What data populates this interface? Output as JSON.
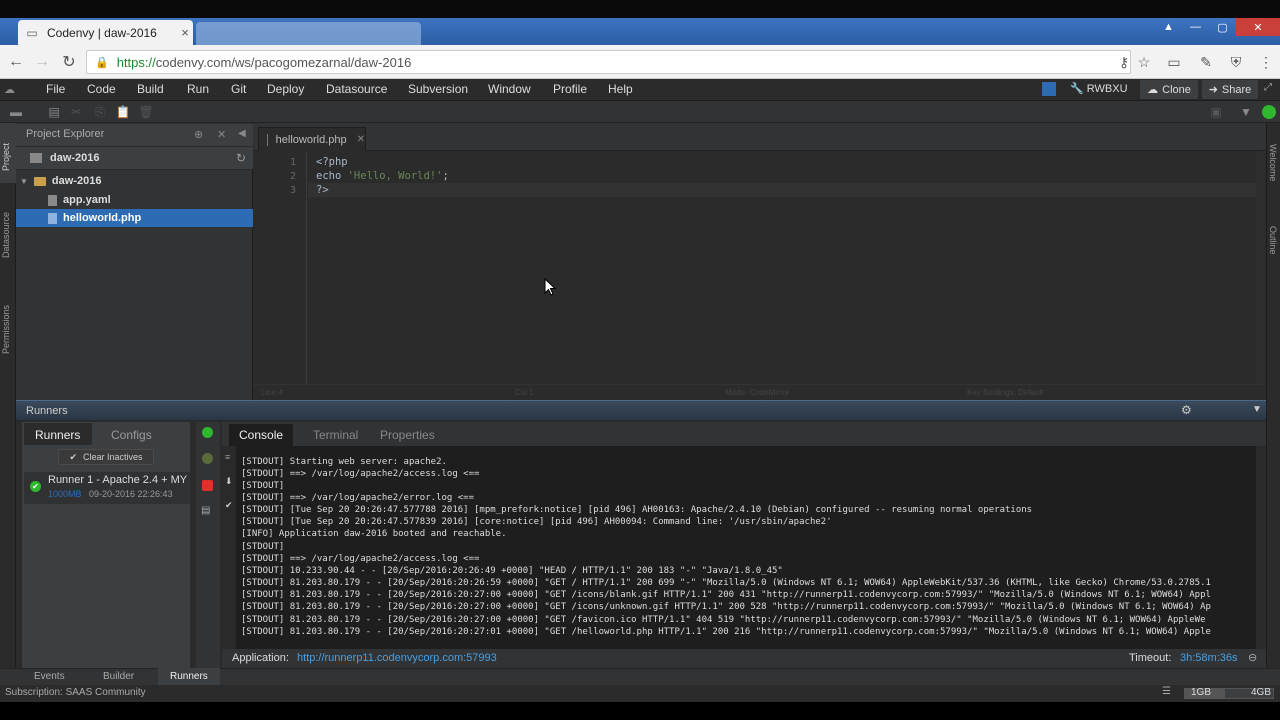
{
  "browser": {
    "tab_title": "Codenvy | daw-2016",
    "tab_close": "×",
    "url_scheme": "https://",
    "url_rest": "codenvy.com/ws/pacogomezarnal/daw-2016",
    "icons": [
      "back-icon",
      "forward-icon",
      "reload-icon",
      "lock-icon",
      "key-icon",
      "star-icon",
      "cast-icon",
      "extension-icon",
      "menu-icon"
    ]
  },
  "menu": [
    "File",
    "Code",
    "Build",
    "Run",
    "Git",
    "Deploy",
    "Datasource",
    "Subversion",
    "Window",
    "Profile",
    "Help"
  ],
  "menu_right": {
    "user": "RWBXU",
    "clone": "Clone",
    "share": "Share"
  },
  "left_strip": [
    "Project",
    "Datasource",
    "Permissions"
  ],
  "right_strip": [
    "Welcome",
    "Outline"
  ],
  "project_explorer": {
    "title": "Project Explorer",
    "root": "daw-2016",
    "folder": "daw-2016",
    "files": [
      "app.yaml",
      "helloworld.php"
    ],
    "selected": "helloworld.php"
  },
  "editor": {
    "tab_label": "helloworld.php",
    "lines": [
      {
        "n": "1",
        "text": "<?php"
      },
      {
        "n": "2",
        "text": "echo ",
        "str": "'Hello, World!'",
        "tail": ";"
      },
      {
        "n": "3",
        "text": "?>"
      }
    ],
    "status": [
      "Line 4",
      "Col 1",
      "Mode: CodeMirror",
      "Key Bindings: Default"
    ]
  },
  "runners": {
    "title": "Runners",
    "tabs": [
      "Runners",
      "Configs"
    ],
    "clear_label": "Clear Inactives",
    "runner_name": "Runner 1 - Apache 2.4 + MY",
    "runner_mem": "1000MB",
    "runner_date": "09-20-2016 22:26:43",
    "console_tabs": [
      "Console",
      "Terminal",
      "Properties"
    ],
    "log": [
      "[STDOUT] Starting web server: apache2.",
      "[STDOUT] ==> /var/log/apache2/access.log <==",
      "[STDOUT]",
      "[STDOUT] ==> /var/log/apache2/error.log <==",
      "[STDOUT] [Tue Sep 20 20:26:47.577788 2016] [mpm_prefork:notice] [pid 496] AH00163: Apache/2.4.10 (Debian) configured -- resuming normal operations",
      "[STDOUT] [Tue Sep 20 20:26:47.577839 2016] [core:notice] [pid 496] AH00094: Command line: '/usr/sbin/apache2'",
      "[INFO] Application daw-2016 booted and reachable.",
      "[STDOUT]",
      "[STDOUT] ==> /var/log/apache2/access.log <==",
      "[STDOUT] 10.233.90.44 - - [20/Sep/2016:20:26:49 +0000] \"HEAD / HTTP/1.1\" 200 183 \"-\" \"Java/1.8.0_45\"",
      "[STDOUT] 81.203.80.179 - - [20/Sep/2016:20:26:59 +0000] \"GET / HTTP/1.1\" 200 699 \"-\" \"Mozilla/5.0 (Windows NT 6.1; WOW64) AppleWebKit/537.36 (KHTML, like Gecko) Chrome/53.0.2785.1",
      "[STDOUT] 81.203.80.179 - - [20/Sep/2016:20:27:00 +0000] \"GET /icons/blank.gif HTTP/1.1\" 200 431 \"http://runnerp11.codenvycorp.com:57993/\" \"Mozilla/5.0 (Windows NT 6.1; WOW64) Appl",
      "[STDOUT] 81.203.80.179 - - [20/Sep/2016:20:27:00 +0000] \"GET /icons/unknown.gif HTTP/1.1\" 200 528 \"http://runnerp11.codenvycorp.com:57993/\" \"Mozilla/5.0 (Windows NT 6.1; WOW64) Ap",
      "[STDOUT] 81.203.80.179 - - [20/Sep/2016:20:27:00 +0000] \"GET /favicon.ico HTTP/1.1\" 404 519 \"http://runnerp11.codenvycorp.com:57993/\" \"Mozilla/5.0 (Windows NT 6.1; WOW64) AppleWe",
      "[STDOUT] 81.203.80.179 - - [20/Sep/2016:20:27:01 +0000] \"GET /helloworld.php HTTP/1.1\" 200 216 \"http://runnerp11.codenvycorp.com:57993/\" \"Mozilla/5.0 (Windows NT 6.1; WOW64) Apple"
    ],
    "app_label": "Application:",
    "app_url": "http://runnerp11.codenvycorp.com:57993",
    "timeout_label": "Timeout:",
    "timeout_value": "3h:58m:36s"
  },
  "bottom_tabs": [
    "Events",
    "Builder",
    "Runners"
  ],
  "status": {
    "subscription": "Subscription: SAAS Community",
    "mem_used": "1GB",
    "mem_total": "4GB"
  },
  "colors": {
    "accent": "#2d6cb5",
    "link": "#4a9fe0",
    "success": "#2eb82e",
    "stop": "#e0302a"
  }
}
